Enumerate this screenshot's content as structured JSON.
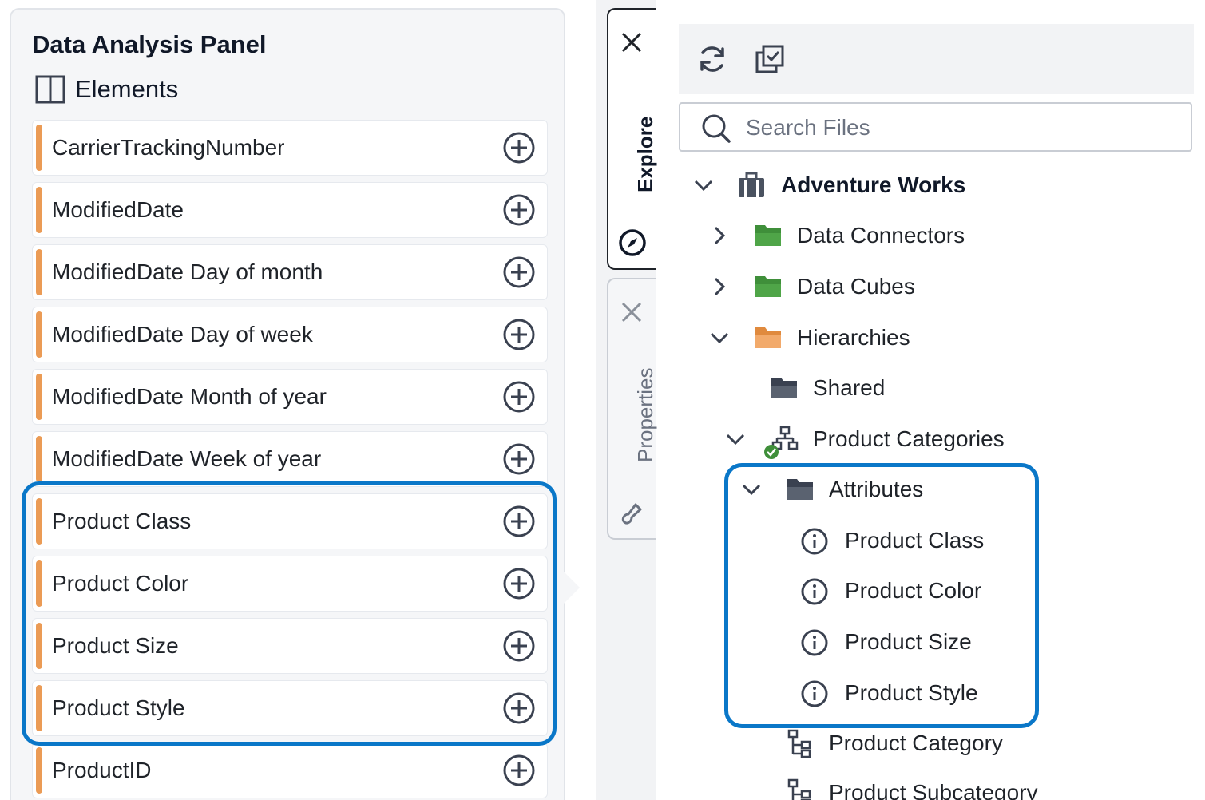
{
  "left_panel": {
    "title": "Data Analysis Panel",
    "elements_heading": "Elements",
    "elements": [
      {
        "name": "CarrierTrackingNumber"
      },
      {
        "name": "ModifiedDate"
      },
      {
        "name": "ModifiedDate Day of month"
      },
      {
        "name": "ModifiedDate Day of week"
      },
      {
        "name": "ModifiedDate Month of year"
      },
      {
        "name": "ModifiedDate Week of year"
      },
      {
        "name": "Product Class"
      },
      {
        "name": "Product Color"
      },
      {
        "name": "Product Size"
      },
      {
        "name": "Product Style"
      },
      {
        "name": "ProductID"
      }
    ],
    "element_accent_color": "#eb9b55",
    "add_icon": "plus-circle-icon"
  },
  "side_tabs": {
    "explore": {
      "label": "Explore",
      "icon": "compass-icon",
      "close_icon": "close-icon"
    },
    "properties": {
      "label": "Properties",
      "icon": "paintbrush-icon",
      "close_icon": "close-icon"
    }
  },
  "toolbar": {
    "refresh_icon": "refresh-icon",
    "select_icon": "multi-select-icon"
  },
  "search": {
    "placeholder": "Search Files",
    "value": ""
  },
  "tree": {
    "root": {
      "label": "Adventure Works",
      "icon": "briefcase-icon"
    },
    "data_connectors": {
      "label": "Data Connectors",
      "icon": "folder-green-icon"
    },
    "data_cubes": {
      "label": "Data Cubes",
      "icon": "folder-green-icon"
    },
    "hierarchies": {
      "label": "Hierarchies",
      "icon": "folder-orange-icon"
    },
    "shared": {
      "label": "Shared",
      "icon": "folder-dark-icon"
    },
    "product_categories": {
      "label": "Product Categories",
      "icon": "hierarchy-check-icon"
    },
    "attributes": {
      "label": "Attributes",
      "icon": "folder-dark-icon"
    },
    "attribute_items": [
      {
        "label": "Product Class"
      },
      {
        "label": "Product Color"
      },
      {
        "label": "Product Size"
      },
      {
        "label": "Product Style"
      }
    ],
    "product_category": {
      "label": "Product Category",
      "icon": "level-icon"
    },
    "product_subcategory": {
      "label": "Product Subcategory",
      "icon": "level-icon"
    }
  },
  "colors": {
    "highlight": "#0a77c8",
    "folder_green": "#3f8f3a",
    "folder_orange": "#ec9d57",
    "folder_dark": "#4a5260"
  }
}
